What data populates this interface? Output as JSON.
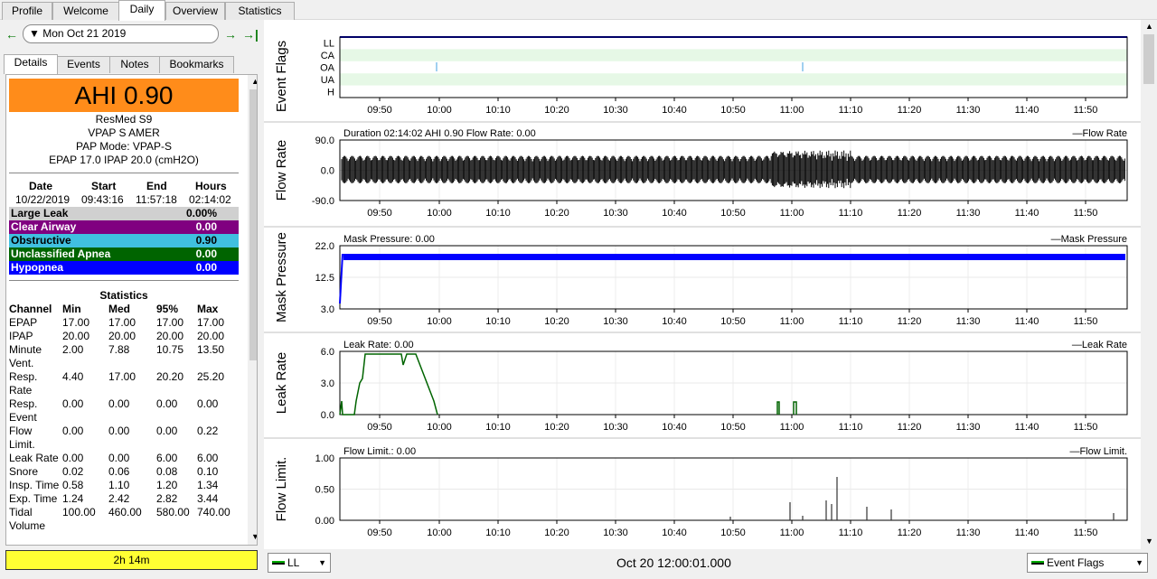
{
  "tabs": [
    {
      "label": "Profile"
    },
    {
      "label": "Welcome"
    },
    {
      "label": "Daily"
    },
    {
      "label": "Overview"
    },
    {
      "label": "Statistics"
    }
  ],
  "nav": {
    "date": "Mon Oct 21 2019",
    "prev": "←",
    "next": "→",
    "last": "→|"
  },
  "subtabs": [
    {
      "label": "Details"
    },
    {
      "label": "Events"
    },
    {
      "label": "Notes"
    },
    {
      "label": "Bookmarks"
    }
  ],
  "details": {
    "ahi": "AHI 0.90",
    "machine": "ResMed S9",
    "model": "VPAP S AMER",
    "mode": "PAP Mode: VPAP-S",
    "settings": "EPAP 17.0 IPAP 20.0 (cmH2O)",
    "session_headers": [
      "Date",
      "Start",
      "End",
      "Hours"
    ],
    "session_values": [
      "10/22/2019",
      "09:43:16",
      "11:57:18",
      "02:14:02"
    ],
    "events": [
      {
        "label": "Large Leak",
        "value": "0.00%",
        "color": "#d0d0d0",
        "text": "#000000"
      },
      {
        "label": "Clear Airway",
        "value": "0.00",
        "color": "#800080",
        "text": "#ffffff"
      },
      {
        "label": "Obstructive",
        "value": "0.90",
        "color": "#40c0e0",
        "text": "#000000"
      },
      {
        "label": "Unclassified Apnea",
        "value": "0.00",
        "color": "#006400",
        "text": "#ffffff"
      },
      {
        "label": "Hypopnea",
        "value": "0.00",
        "color": "#0000ff",
        "text": "#ffffff"
      }
    ],
    "stats_title": "Statistics",
    "stats_headers": [
      "Channel",
      "Min",
      "Med",
      "95%",
      "Max"
    ],
    "stats_rows": [
      {
        "ch": "EPAP",
        "ch2": "",
        "min": "17.00",
        "med": "17.00",
        "p95": "17.00",
        "max": "17.00"
      },
      {
        "ch": "IPAP",
        "ch2": "",
        "min": "20.00",
        "med": "20.00",
        "p95": "20.00",
        "max": "20.00"
      },
      {
        "ch": "Minute",
        "ch2": "Vent.",
        "min": "2.00",
        "med": "7.88",
        "p95": "10.75",
        "max": "13.50"
      },
      {
        "ch": "Resp.",
        "ch2": "Rate",
        "min": "4.40",
        "med": "17.00",
        "p95": "20.20",
        "max": "25.20"
      },
      {
        "ch": "Resp.",
        "ch2": "Event",
        "min": "0.00",
        "med": "0.00",
        "p95": "0.00",
        "max": "0.00"
      },
      {
        "ch": "Flow",
        "ch2": "Limit.",
        "min": "0.00",
        "med": "0.00",
        "p95": "0.00",
        "max": "0.22"
      },
      {
        "ch": "Leak Rate",
        "ch2": "",
        "min": "0.00",
        "med": "0.00",
        "p95": "6.00",
        "max": "6.00"
      },
      {
        "ch": "Snore",
        "ch2": "",
        "min": "0.02",
        "med": "0.06",
        "p95": "0.08",
        "max": "0.10"
      },
      {
        "ch": "Insp. Time",
        "ch2": "",
        "min": "0.58",
        "med": "1.10",
        "p95": "1.20",
        "max": "1.34"
      },
      {
        "ch": "Exp. Time",
        "ch2": "",
        "min": "1.24",
        "med": "2.42",
        "p95": "2.82",
        "max": "3.44"
      },
      {
        "ch": "Tidal",
        "ch2": "Volume",
        "min": "100.00",
        "med": "460.00",
        "p95": "580.00",
        "max": "740.00"
      }
    ],
    "duration": "2h 14m"
  },
  "graphs": {
    "x_ticks": [
      "09:50",
      "10:00",
      "10:10",
      "10:20",
      "10:30",
      "10:40",
      "10:50",
      "11:00",
      "11:10",
      "11:20",
      "11:30",
      "11:40",
      "11:50"
    ],
    "event_flags": {
      "label": "Event Flags",
      "rows": [
        "LL",
        "CA",
        "OA",
        "UA",
        "H"
      ]
    },
    "flow_rate": {
      "label": "Flow Rate",
      "info": "Duration 02:14:02 AHI 0.90 Flow Rate: 0.00",
      "legend": "Flow Rate",
      "ticks": [
        "90.0",
        "0.0",
        "-90.0"
      ]
    },
    "mask_pressure": {
      "label": "Mask Pressure",
      "info": "Mask Pressure: 0.00",
      "legend": "Mask Pressure",
      "ticks": [
        "22.0",
        "12.5",
        "3.0"
      ]
    },
    "leak_rate": {
      "label": "Leak Rate",
      "info": "Leak Rate: 0.00",
      "legend": "Leak Rate",
      "ticks": [
        "6.0",
        "3.0",
        "0.0"
      ]
    },
    "flow_limit": {
      "label": "Flow Limit.",
      "info": "Flow Limit.: 0.00",
      "legend": "Flow Limit.",
      "ticks": [
        "1.00",
        "0.50",
        "0.00"
      ]
    }
  },
  "bottom": {
    "left_combo": "LL",
    "timestamp": "Oct 20 12:00:01.000",
    "right_combo": "Event Flags"
  },
  "colors": {
    "ahi_bg": "#ff8c1a",
    "flow": "#000000",
    "pressure": "#0000ff",
    "leak": "#006400",
    "event_band": "#e6f8e6"
  }
}
